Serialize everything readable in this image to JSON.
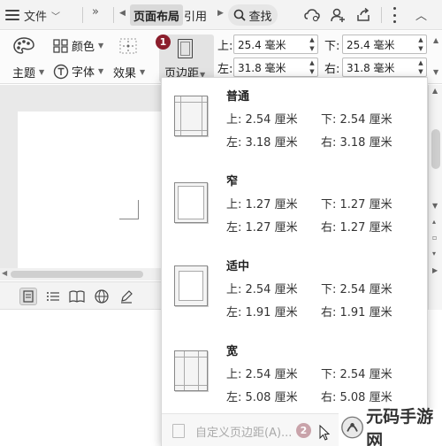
{
  "tabbar": {
    "file_label": "文件",
    "active_tab": "页面布局",
    "ref_tab": "引用",
    "find_label": "查找"
  },
  "ribbon": {
    "theme_label": "主题",
    "color_label": "颜色",
    "font_label": "字体",
    "effect_label": "效果",
    "margins_label": "页边距",
    "margins_badge": "1",
    "top_label": "上:",
    "bottom_label": "下:",
    "left_label": "左:",
    "right_label": "右:",
    "top_value": "25.4 毫米",
    "bottom_value": "25.4 毫米",
    "left_value": "31.8 毫米",
    "right_value": "31.8 毫米"
  },
  "presets": [
    {
      "name": "普通",
      "top": "上: 2.54 厘米",
      "bottom": "下: 2.54 厘米",
      "left": "左: 3.18 厘米",
      "right": "右: 3.18 厘米",
      "style": "normal"
    },
    {
      "name": "窄",
      "top": "上: 1.27 厘米",
      "bottom": "下: 1.27 厘米",
      "left": "左: 1.27 厘米",
      "right": "右: 1.27 厘米",
      "style": "narrow"
    },
    {
      "name": "适中",
      "top": "上: 2.54 厘米",
      "bottom": "下: 2.54 厘米",
      "left": "左: 1.91 厘米",
      "right": "右: 1.91 厘米",
      "style": "moderate"
    },
    {
      "name": "宽",
      "top": "上: 2.54 厘米",
      "bottom": "下: 2.54 厘米",
      "left": "左: 5.08 厘米",
      "right": "右: 5.08 厘米",
      "style": "wide"
    }
  ],
  "footer": {
    "custom_label": "自定义页边距(A)...",
    "badge": "2"
  },
  "watermark": {
    "text": "元码手游网"
  },
  "colors": {
    "badge_dark": "#8b1e2c",
    "badge_soft": "#c9a3aa",
    "active_tab_bg": "#d9d9d9"
  }
}
